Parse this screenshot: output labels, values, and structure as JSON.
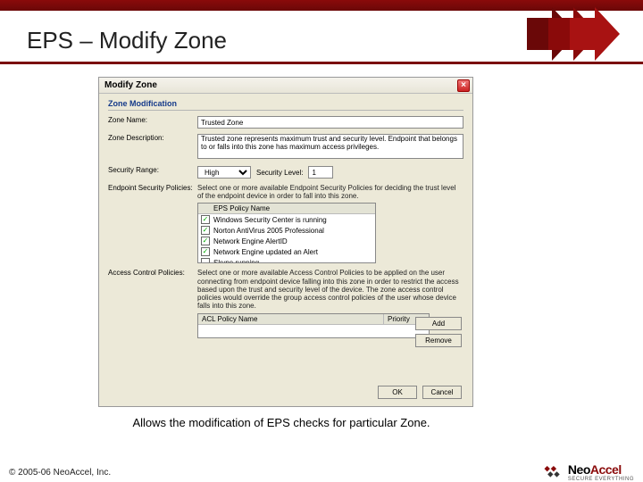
{
  "slide": {
    "title": "EPS – Modify Zone",
    "caption": "Allows the modification of EPS checks for particular Zone.",
    "copyright": "© 2005-06 NeoAccel, Inc."
  },
  "logo": {
    "name": "NeoAccel",
    "name_prefix": "Neo",
    "name_suffix": "Accel",
    "tagline": "Secure Everything"
  },
  "dialog": {
    "title": "Modify Zone",
    "close_glyph": "×",
    "group": "Zone Modification",
    "labels": {
      "zone_name": "Zone Name:",
      "zone_desc": "Zone Description:",
      "sec_range": "Security Range:",
      "sec_level": "Security Level:",
      "eps_policies": "Endpoint Security Policies:",
      "acl_policies": "Access Control Policies:"
    },
    "values": {
      "zone_name": "Trusted Zone",
      "zone_desc": "Trusted zone represents maximum trust and security level. Endpoint that belongs to or falls into this zone has maximum access privileges.",
      "sec_range": "High",
      "sec_level": "1"
    },
    "eps_help": "Select one or more available Endpoint Security Policies for deciding the trust level of the endpoint device in order to fall into this zone.",
    "eps_list": {
      "header": "EPS Policy Name",
      "items": [
        {
          "checked": true,
          "label": "Windows Security Center is running"
        },
        {
          "checked": true,
          "label": "Norton AntiVirus 2005 Professional"
        },
        {
          "checked": true,
          "label": "Network Engine AlertID"
        },
        {
          "checked": true,
          "label": "Network Engine updated an Alert"
        },
        {
          "checked": false,
          "label": "Skype running"
        }
      ]
    },
    "acl_help": "Select one or more available Access Control Policies to be applied on the user connecting from endpoint device falling into this zone in order to restrict the access based upon the trust and security level of the device. The zone access control policies would override the group access control policies of the user whose device falls into this zone.",
    "acl_list": {
      "col1": "ACL Policy Name",
      "col2": "Priority"
    },
    "buttons": {
      "add": "Add",
      "remove": "Remove",
      "ok": "OK",
      "cancel": "Cancel"
    }
  }
}
